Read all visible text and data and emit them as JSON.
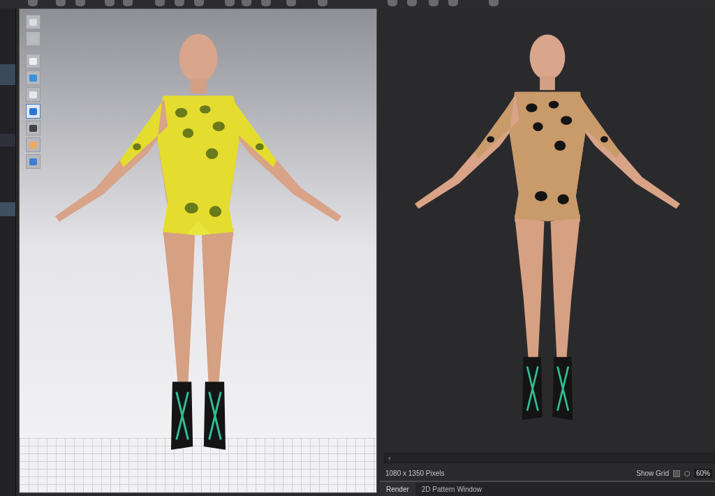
{
  "viewport_tools": [
    {
      "selected": false
    },
    {
      "selected": false
    },
    {
      "selected": false
    },
    {
      "selected": false
    },
    {
      "selected": false
    },
    {
      "selected": true
    },
    {
      "selected": false
    },
    {
      "selected": false
    },
    {
      "selected": false
    }
  ],
  "render_panel": {
    "resolution": "1080 x 1350 Pixels",
    "show_grid": {
      "label": "Show Grid",
      "checked": false
    },
    "zoom": "60%"
  },
  "tabs": [
    {
      "label": "Render",
      "selected": true
    },
    {
      "label": "2D Pattern Window",
      "selected": false
    }
  ]
}
